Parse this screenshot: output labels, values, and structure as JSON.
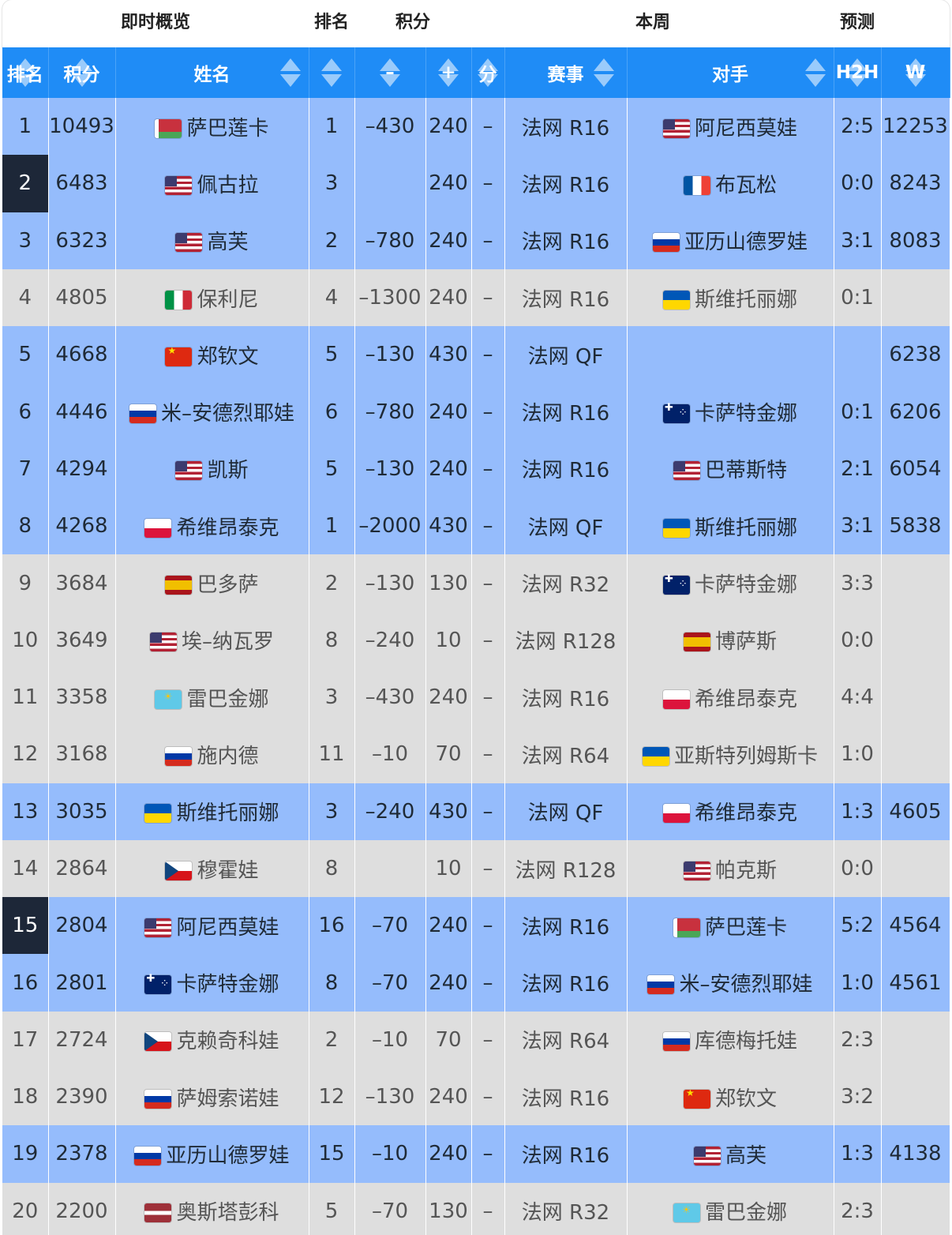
{
  "groups": {
    "overview": "即时概览",
    "rank": "排名",
    "points": "积分",
    "week": "本周",
    "forecast": "预测"
  },
  "columns": {
    "rank": "排名",
    "points": "积分",
    "name": "姓名",
    "change": "",
    "minus": "–",
    "plus": "+",
    "score": "分",
    "event": "赛事",
    "opponent": "对手",
    "h2h": "H2H",
    "w": "W"
  },
  "flag_colors": {
    "header_blue": "#1f8cf6",
    "row_blue": "#95bcfc",
    "row_gray": "#dedede",
    "rank_marker": "#1d2738"
  },
  "rows": [
    {
      "rank": "1",
      "points": "10493",
      "flag": "BLR",
      "name": "萨巴莲卡",
      "rankw": "1",
      "minus": "–430",
      "plus": "240",
      "dash": "–",
      "event": "法网 R16",
      "oppflag": "USA",
      "opp": "阿尼西莫娃",
      "h2h": "2:5",
      "w": "12253",
      "style": "blue",
      "marked": false
    },
    {
      "rank": "2",
      "points": "6483",
      "flag": "USA",
      "name": "佩古拉",
      "rankw": "3",
      "minus": "",
      "plus": "240",
      "dash": "–",
      "event": "法网 R16",
      "oppflag": "FRA",
      "opp": "布瓦松",
      "h2h": "0:0",
      "w": "8243",
      "style": "blue",
      "marked": true
    },
    {
      "rank": "3",
      "points": "6323",
      "flag": "USA",
      "name": "高芙",
      "rankw": "2",
      "minus": "–780",
      "plus": "240",
      "dash": "–",
      "event": "法网 R16",
      "oppflag": "RUS",
      "opp": "亚历山德罗娃",
      "h2h": "3:1",
      "w": "8083",
      "style": "blue",
      "marked": false
    },
    {
      "rank": "4",
      "points": "4805",
      "flag": "ITA",
      "name": "保利尼",
      "rankw": "4",
      "minus": "–1300",
      "plus": "240",
      "dash": "–",
      "event": "法网 R16",
      "oppflag": "UKR",
      "opp": "斯维托丽娜",
      "h2h": "0:1",
      "w": "",
      "style": "gray",
      "marked": false
    },
    {
      "rank": "5",
      "points": "4668",
      "flag": "CHN",
      "name": "郑钦文",
      "rankw": "5",
      "minus": "–130",
      "plus": "430",
      "dash": "–",
      "event": "法网 QF",
      "oppflag": "",
      "opp": "",
      "h2h": "",
      "w": "6238",
      "style": "blue",
      "marked": false
    },
    {
      "rank": "6",
      "points": "4446",
      "flag": "RUS",
      "name": "米–安德烈耶娃",
      "rankw": "6",
      "minus": "–780",
      "plus": "240",
      "dash": "–",
      "event": "法网 R16",
      "oppflag": "AUS",
      "opp": "卡萨特金娜",
      "h2h": "0:1",
      "w": "6206",
      "style": "blue",
      "marked": false
    },
    {
      "rank": "7",
      "points": "4294",
      "flag": "USA",
      "name": "凯斯",
      "rankw": "5",
      "minus": "–130",
      "plus": "240",
      "dash": "–",
      "event": "法网 R16",
      "oppflag": "USA",
      "opp": "巴蒂斯特",
      "h2h": "2:1",
      "w": "6054",
      "style": "blue",
      "marked": false
    },
    {
      "rank": "8",
      "points": "4268",
      "flag": "POL",
      "name": "希维昂泰克",
      "rankw": "1",
      "minus": "–2000",
      "plus": "430",
      "dash": "–",
      "event": "法网 QF",
      "oppflag": "UKR",
      "opp": "斯维托丽娜",
      "h2h": "3:1",
      "w": "5838",
      "style": "blue",
      "marked": false
    },
    {
      "rank": "9",
      "points": "3684",
      "flag": "ESP",
      "name": "巴多萨",
      "rankw": "2",
      "minus": "–130",
      "plus": "130",
      "dash": "–",
      "event": "法网 R32",
      "oppflag": "AUS",
      "opp": "卡萨特金娜",
      "h2h": "3:3",
      "w": "",
      "style": "gray",
      "marked": false
    },
    {
      "rank": "10",
      "points": "3649",
      "flag": "USA",
      "name": "埃–纳瓦罗",
      "rankw": "8",
      "minus": "–240",
      "plus": "10",
      "dash": "–",
      "event": "法网 R128",
      "oppflag": "ESP",
      "opp": "博萨斯",
      "h2h": "0:0",
      "w": "",
      "style": "gray",
      "marked": false
    },
    {
      "rank": "11",
      "points": "3358",
      "flag": "KAZ",
      "name": "雷巴金娜",
      "rankw": "3",
      "minus": "–430",
      "plus": "240",
      "dash": "–",
      "event": "法网 R16",
      "oppflag": "POL",
      "opp": "希维昂泰克",
      "h2h": "4:4",
      "w": "",
      "style": "gray",
      "marked": false
    },
    {
      "rank": "12",
      "points": "3168",
      "flag": "RUS",
      "name": "施内德",
      "rankw": "11",
      "minus": "–10",
      "plus": "70",
      "dash": "–",
      "event": "法网 R64",
      "oppflag": "UKR",
      "opp": "亚斯特列姆斯卡",
      "h2h": "1:0",
      "w": "",
      "style": "gray",
      "marked": false
    },
    {
      "rank": "13",
      "points": "3035",
      "flag": "UKR",
      "name": "斯维托丽娜",
      "rankw": "3",
      "minus": "–240",
      "plus": "430",
      "dash": "–",
      "event": "法网 QF",
      "oppflag": "POL",
      "opp": "希维昂泰克",
      "h2h": "1:3",
      "w": "4605",
      "style": "blue",
      "marked": false
    },
    {
      "rank": "14",
      "points": "2864",
      "flag": "CZE",
      "name": "穆霍娃",
      "rankw": "8",
      "minus": "",
      "plus": "10",
      "dash": "–",
      "event": "法网 R128",
      "oppflag": "USA",
      "opp": "帕克斯",
      "h2h": "0:0",
      "w": "",
      "style": "gray",
      "marked": false
    },
    {
      "rank": "15",
      "points": "2804",
      "flag": "USA",
      "name": "阿尼西莫娃",
      "rankw": "16",
      "minus": "–70",
      "plus": "240",
      "dash": "–",
      "event": "法网 R16",
      "oppflag": "BLR",
      "opp": "萨巴莲卡",
      "h2h": "5:2",
      "w": "4564",
      "style": "blue",
      "marked": true
    },
    {
      "rank": "16",
      "points": "2801",
      "flag": "AUS",
      "name": "卡萨特金娜",
      "rankw": "8",
      "minus": "–70",
      "plus": "240",
      "dash": "–",
      "event": "法网 R16",
      "oppflag": "RUS",
      "opp": "米–安德烈耶娃",
      "h2h": "1:0",
      "w": "4561",
      "style": "blue",
      "marked": false
    },
    {
      "rank": "17",
      "points": "2724",
      "flag": "CZE",
      "name": "克赖奇科娃",
      "rankw": "2",
      "minus": "–10",
      "plus": "70",
      "dash": "–",
      "event": "法网 R64",
      "oppflag": "RUS",
      "opp": "库德梅托娃",
      "h2h": "2:3",
      "w": "",
      "style": "gray",
      "marked": false
    },
    {
      "rank": "18",
      "points": "2390",
      "flag": "RUS",
      "name": "萨姆索诺娃",
      "rankw": "12",
      "minus": "–130",
      "plus": "240",
      "dash": "–",
      "event": "法网 R16",
      "oppflag": "CHN",
      "opp": "郑钦文",
      "h2h": "3:2",
      "w": "",
      "style": "gray",
      "marked": false
    },
    {
      "rank": "19",
      "points": "2378",
      "flag": "RUS",
      "name": "亚历山德罗娃",
      "rankw": "15",
      "minus": "–10",
      "plus": "240",
      "dash": "–",
      "event": "法网 R16",
      "oppflag": "USA",
      "opp": "高芙",
      "h2h": "1:3",
      "w": "4138",
      "style": "blue",
      "marked": false
    },
    {
      "rank": "20",
      "points": "2200",
      "flag": "LAT",
      "name": "奥斯塔彭科",
      "rankw": "5",
      "minus": "–70",
      "plus": "130",
      "dash": "–",
      "event": "法网 R32",
      "oppflag": "KAZ",
      "opp": "雷巴金娜",
      "h2h": "2:3",
      "w": "",
      "style": "gray",
      "marked": false
    }
  ]
}
